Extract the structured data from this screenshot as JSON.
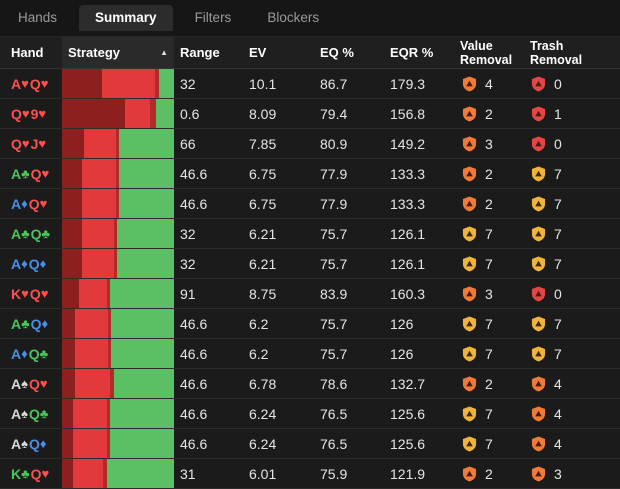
{
  "tabs": [
    "Hands",
    "Summary",
    "Filters",
    "Blockers"
  ],
  "active_tab": 1,
  "columns": {
    "hand": "Hand",
    "strategy": "Strategy",
    "range": "Range",
    "ev": "EV",
    "eq": "EQ %",
    "eqr": "EQR %",
    "value_removal": [
      "Value",
      "Removal"
    ],
    "trash_removal": [
      "Trash",
      "Removal"
    ]
  },
  "colors": {
    "heart": "#ff4f4f",
    "diamond": "#4a8fe7",
    "club": "#4cc35a",
    "spade": "#d8d8d8",
    "strategy_dark": "#8e1f1f",
    "strategy_mid": "#b22a2a",
    "strategy_red": "#e23a3a",
    "strategy_green": "#5cbf64",
    "shield_orange": "#f07a3a",
    "shield_red": "#e54545",
    "shield_yellow": "#f0b43c"
  },
  "rows": [
    {
      "hand": [
        [
          "A",
          "heart"
        ],
        [
          "Q",
          "heart"
        ]
      ],
      "strategy": [
        0.36,
        0.47,
        0.04,
        0.13
      ],
      "range": "32",
      "ev": "10.1",
      "eq": "86.7",
      "eqr": "179.3",
      "value": {
        "n": "4",
        "icon": "orange"
      },
      "trash": {
        "n": "0",
        "icon": "red"
      }
    },
    {
      "hand": [
        [
          "Q",
          "heart"
        ],
        [
          "9",
          "heart"
        ]
      ],
      "strategy": [
        0.56,
        0.23,
        0.05,
        0.16
      ],
      "range": "0.6",
      "ev": "8.09",
      "eq": "79.4",
      "eqr": "156.8",
      "value": {
        "n": "2",
        "icon": "orange"
      },
      "trash": {
        "n": "1",
        "icon": "red"
      }
    },
    {
      "hand": [
        [
          "Q",
          "heart"
        ],
        [
          "J",
          "heart"
        ]
      ],
      "strategy": [
        0.2,
        0.28,
        0.03,
        0.49
      ],
      "range": "66",
      "ev": "7.85",
      "eq": "80.9",
      "eqr": "149.2",
      "value": {
        "n": "3",
        "icon": "orange"
      },
      "trash": {
        "n": "0",
        "icon": "red"
      }
    },
    {
      "hand": [
        [
          "A",
          "club"
        ],
        [
          "Q",
          "heart"
        ]
      ],
      "strategy": [
        0.18,
        0.3,
        0.03,
        0.49
      ],
      "range": "46.6",
      "ev": "6.75",
      "eq": "77.9",
      "eqr": "133.3",
      "value": {
        "n": "2",
        "icon": "orange"
      },
      "trash": {
        "n": "7",
        "icon": "yellow"
      }
    },
    {
      "hand": [
        [
          "A",
          "diamond"
        ],
        [
          "Q",
          "heart"
        ]
      ],
      "strategy": [
        0.18,
        0.3,
        0.03,
        0.49
      ],
      "range": "46.6",
      "ev": "6.75",
      "eq": "77.9",
      "eqr": "133.3",
      "value": {
        "n": "2",
        "icon": "orange"
      },
      "trash": {
        "n": "7",
        "icon": "yellow"
      }
    },
    {
      "hand": [
        [
          "A",
          "club"
        ],
        [
          "Q",
          "club"
        ]
      ],
      "strategy": [
        0.18,
        0.28,
        0.03,
        0.51
      ],
      "range": "32",
      "ev": "6.21",
      "eq": "75.7",
      "eqr": "126.1",
      "value": {
        "n": "7",
        "icon": "yellow"
      },
      "trash": {
        "n": "7",
        "icon": "yellow"
      }
    },
    {
      "hand": [
        [
          "A",
          "diamond"
        ],
        [
          "Q",
          "diamond"
        ]
      ],
      "strategy": [
        0.18,
        0.28,
        0.03,
        0.51
      ],
      "range": "32",
      "ev": "6.21",
      "eq": "75.7",
      "eqr": "126.1",
      "value": {
        "n": "7",
        "icon": "yellow"
      },
      "trash": {
        "n": "7",
        "icon": "yellow"
      }
    },
    {
      "hand": [
        [
          "K",
          "heart"
        ],
        [
          "Q",
          "heart"
        ]
      ],
      "strategy": [
        0.15,
        0.25,
        0.03,
        0.57
      ],
      "range": "91",
      "ev": "8.75",
      "eq": "83.9",
      "eqr": "160.3",
      "value": {
        "n": "3",
        "icon": "orange"
      },
      "trash": {
        "n": "0",
        "icon": "red"
      }
    },
    {
      "hand": [
        [
          "A",
          "club"
        ],
        [
          "Q",
          "diamond"
        ]
      ],
      "strategy": [
        0.12,
        0.29,
        0.03,
        0.56
      ],
      "range": "46.6",
      "ev": "6.2",
      "eq": "75.7",
      "eqr": "126",
      "value": {
        "n": "7",
        "icon": "yellow"
      },
      "trash": {
        "n": "7",
        "icon": "yellow"
      }
    },
    {
      "hand": [
        [
          "A",
          "diamond"
        ],
        [
          "Q",
          "club"
        ]
      ],
      "strategy": [
        0.12,
        0.29,
        0.03,
        0.56
      ],
      "range": "46.6",
      "ev": "6.2",
      "eq": "75.7",
      "eqr": "126",
      "value": {
        "n": "7",
        "icon": "yellow"
      },
      "trash": {
        "n": "7",
        "icon": "yellow"
      }
    },
    {
      "hand": [
        [
          "A",
          "spade"
        ],
        [
          "Q",
          "heart"
        ]
      ],
      "strategy": [
        0.12,
        0.31,
        0.03,
        0.54
      ],
      "range": "46.6",
      "ev": "6.78",
      "eq": "78.6",
      "eqr": "132.7",
      "value": {
        "n": "2",
        "icon": "orange"
      },
      "trash": {
        "n": "4",
        "icon": "orange"
      }
    },
    {
      "hand": [
        [
          "A",
          "spade"
        ],
        [
          "Q",
          "club"
        ]
      ],
      "strategy": [
        0.1,
        0.3,
        0.03,
        0.57
      ],
      "range": "46.6",
      "ev": "6.24",
      "eq": "76.5",
      "eqr": "125.6",
      "value": {
        "n": "7",
        "icon": "yellow"
      },
      "trash": {
        "n": "4",
        "icon": "orange"
      }
    },
    {
      "hand": [
        [
          "A",
          "spade"
        ],
        [
          "Q",
          "diamond"
        ]
      ],
      "strategy": [
        0.1,
        0.3,
        0.03,
        0.57
      ],
      "range": "46.6",
      "ev": "6.24",
      "eq": "76.5",
      "eqr": "125.6",
      "value": {
        "n": "7",
        "icon": "yellow"
      },
      "trash": {
        "n": "4",
        "icon": "orange"
      }
    },
    {
      "hand": [
        [
          "K",
          "club"
        ],
        [
          "Q",
          "heart"
        ]
      ],
      "strategy": [
        0.1,
        0.27,
        0.03,
        0.6
      ],
      "range": "31",
      "ev": "6.01",
      "eq": "75.9",
      "eqr": "121.9",
      "value": {
        "n": "2",
        "icon": "orange"
      },
      "trash": {
        "n": "3",
        "icon": "orange"
      }
    }
  ]
}
